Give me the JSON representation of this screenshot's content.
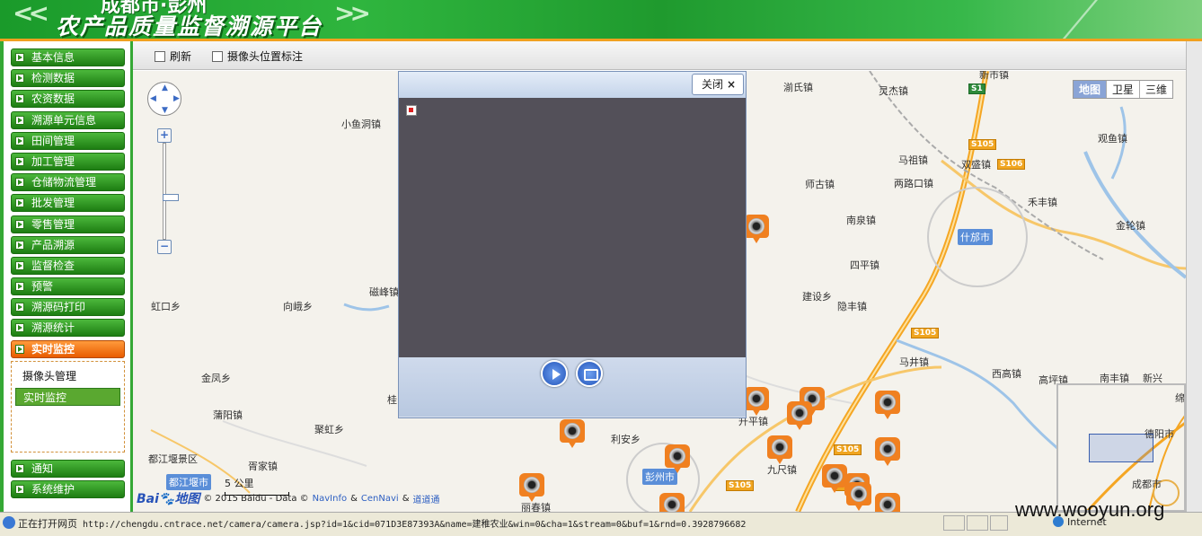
{
  "banner": {
    "title_top": "成都市·彭州",
    "title": "农产品质量监督溯源平台"
  },
  "menu": {
    "items": [
      "基本信息",
      "检测数据",
      "农资数据",
      "溯源单元信息",
      "田间管理",
      "加工管理",
      "仓储物流管理",
      "批发管理",
      "零售管理",
      "产品溯源",
      "监督检查",
      "预警",
      "溯源码打印",
      "溯源统计",
      "实时监控"
    ],
    "active": "实时监控",
    "submenu": [
      "摄像头管理",
      "实时监控"
    ],
    "submenu_selected": "实时监控",
    "bottom_items": [
      "通知",
      "系统维护"
    ]
  },
  "toolbar": {
    "refresh": "刷新",
    "mark_camera": "摄像头位置标注"
  },
  "map": {
    "map_types": [
      "地图",
      "卫星",
      "三维"
    ],
    "active_type": "地图",
    "places": [
      "小鱼洞镇",
      "湔氏镇",
      "灵杰镇",
      "新市镇",
      "磁峰镇",
      "虹口乡",
      "向峨乡",
      "马祖镇",
      "双盛镇",
      "观鱼镇",
      "禾丰镇",
      "金轮镇",
      "两路口镇",
      "师古镇",
      "南泉镇",
      "四平镇",
      "建设乡",
      "隐丰镇",
      "马井镇",
      "西高镇",
      "高坪镇",
      "南丰镇",
      "新兴",
      "金凤乡",
      "蒲阳镇",
      "聚虹乡",
      "胥家镇",
      "利安乡",
      "九尺镇",
      "升平镇",
      "丽春镇",
      "桂",
      "都江堰景区"
    ],
    "city_labels": [
      "什邡市",
      "彭州市",
      "都江堰市"
    ],
    "highways": [
      "S1",
      "S105",
      "S106",
      "S105",
      "S105",
      "S105",
      "S105"
    ],
    "scale": "5 公里",
    "copyright": "© 2015 Baidu - Data ©",
    "copyright_links": [
      "NavInfo",
      "&",
      "CenNavi",
      "&",
      "道道通"
    ],
    "logo_text": "Bai",
    "logo_text2": "地图",
    "overview_places": [
      "德阳市",
      "成都市",
      "绵"
    ]
  },
  "dialog": {
    "close_label": "关闭",
    "close_symbol": "×"
  },
  "statusbar": {
    "prefix": "正在打开网页",
    "url": "http://chengdu.cntrace.net/camera/camera.jsp?id=1&cid=071D3E87393A&name=建稚农业&win=0&cha=1&stream=0&buf=1&rnd=0.3928796682",
    "zone": "Internet"
  },
  "watermark": "www.wooyun.org"
}
